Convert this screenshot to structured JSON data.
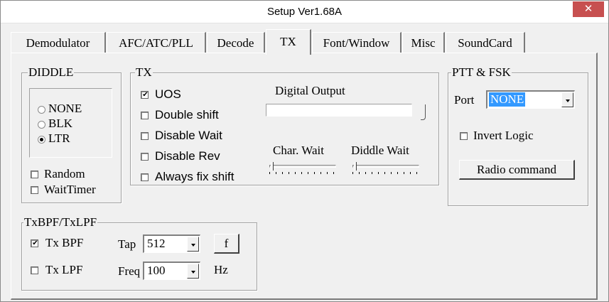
{
  "window": {
    "title": "Setup Ver1.68A",
    "close_glyph": "✕"
  },
  "tabs": [
    {
      "label": "Demodulator",
      "active": false
    },
    {
      "label": "AFC/ATC/PLL",
      "active": false
    },
    {
      "label": "Decode",
      "active": false
    },
    {
      "label": "TX",
      "active": true
    },
    {
      "label": "Font/Window",
      "active": false
    },
    {
      "label": "Misc",
      "active": false
    },
    {
      "label": "SoundCard",
      "active": false
    }
  ],
  "diddle": {
    "title": "DIDDLE",
    "options": [
      {
        "label": "NONE",
        "selected": false
      },
      {
        "label": "BLK",
        "selected": false
      },
      {
        "label": "LTR",
        "selected": true
      }
    ],
    "random_label": "Random",
    "random_checked": false,
    "waittimer_label": "WaitTimer",
    "waittimer_checked": false
  },
  "tx": {
    "title": "TX",
    "uos_label": "UOS",
    "uos_checked": true,
    "double_shift_label": "Double shift",
    "double_shift_checked": false,
    "disable_wait_label": "Disable Wait",
    "disable_wait_checked": false,
    "disable_rev_label": "Disable Rev",
    "disable_rev_checked": false,
    "always_fix_shift_label": "Always fix shift",
    "always_fix_shift_checked": false,
    "digital_output_label": "Digital Output",
    "char_wait_label": "Char. Wait",
    "diddle_wait_label": "Diddle Wait"
  },
  "ptt": {
    "title": "PTT & FSK",
    "port_label": "Port",
    "port_value": "NONE",
    "invert_logic_label": "Invert Logic",
    "invert_logic_checked": false,
    "radio_command_label": "Radio command"
  },
  "txbpf": {
    "title": "TxBPF/TxLPF",
    "txbpf_label": "Tx BPF",
    "txbpf_checked": true,
    "txlpf_label": "Tx LPF",
    "txlpf_checked": false,
    "tap_label": "Tap",
    "tap_value": "512",
    "f_button_label": "f",
    "freq_label": "Freq",
    "freq_value": "100",
    "hz_label": "Hz"
  },
  "glyphs": {
    "check": "✔",
    "icons": [
      "close-icon",
      "dropdown-arrow-icon",
      "check-mark-icon"
    ]
  }
}
